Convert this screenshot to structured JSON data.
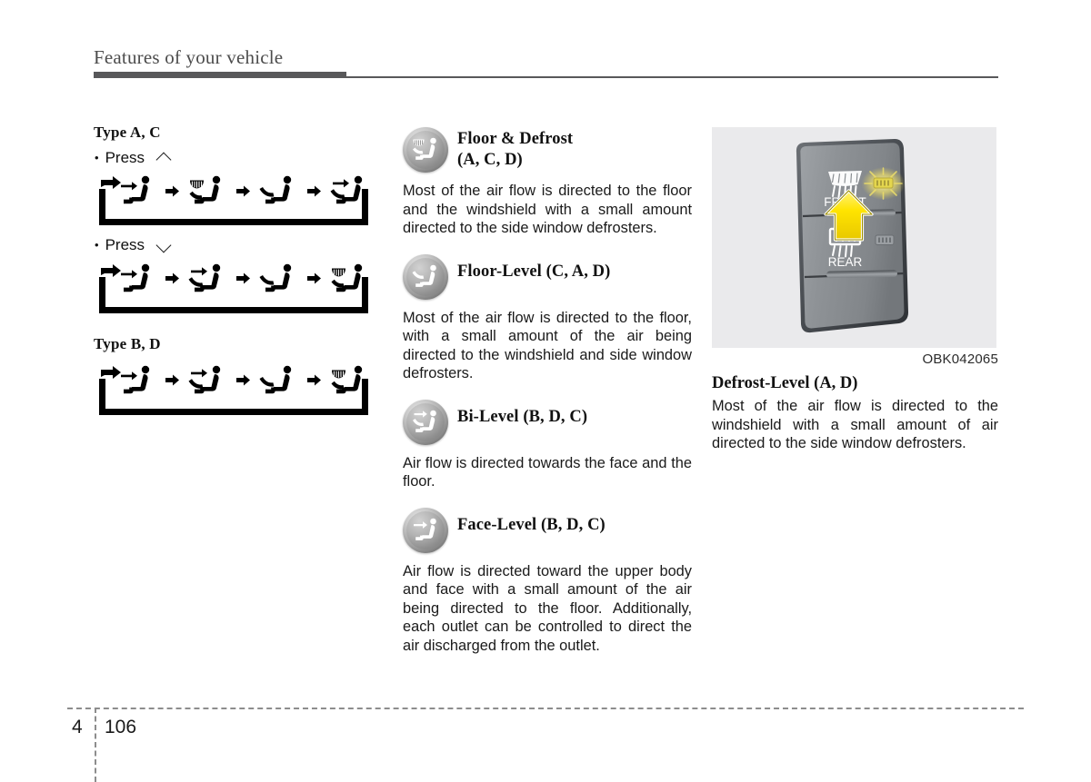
{
  "header": {
    "title": "Features of your vehicle"
  },
  "left_column": {
    "type_ac_heading": "Type A, C",
    "press_up": {
      "bullet": "•",
      "label": "Press",
      "icon": "chevron-up-icon"
    },
    "press_down": {
      "bullet": "•",
      "label": "Press",
      "icon": "chevron-down-icon"
    },
    "type_bd_heading": "Type B, D",
    "flow_up": {
      "name": "airflow-cycle-press-up",
      "modes": [
        "face-level",
        "floor-and-defrost",
        "floor-level",
        "bi-level"
      ]
    },
    "flow_down": {
      "name": "airflow-cycle-press-down",
      "modes": [
        "face-level",
        "bi-level",
        "floor-level",
        "floor-and-defrost"
      ]
    },
    "flow_bd": {
      "name": "airflow-cycle-type-b-d",
      "modes": [
        "face-level",
        "bi-level",
        "floor-level",
        "floor-and-defrost"
      ]
    }
  },
  "mid_column": {
    "entries": [
      {
        "icon": "floor-and-defrost-icon",
        "title_line1": "Floor & Defrost",
        "title_line2": "(A, C, D)",
        "body": "Most of the air flow is directed to the floor and the windshield with a small amount directed to the side window defrosters."
      },
      {
        "icon": "floor-level-icon",
        "title_line1": "Floor-Level (C, A, D)",
        "title_line2": "",
        "body": "Most of the air flow is directed to the floor, with a small amount of the air being directed to the windshield and side window defrosters."
      },
      {
        "icon": "bi-level-icon",
        "title_line1": "Bi-Level (B, D, C)",
        "title_line2": "",
        "body": "Air flow is directed towards the face and the floor."
      },
      {
        "icon": "face-level-icon",
        "title_line1": "Face-Level (B, D, C)",
        "title_line2": "",
        "body": "Air flow is directed toward the upper body and face with a small amount of the air being directed to the floor. Additionally, each outlet can be controlled to direct the air discharged from the outlet."
      }
    ]
  },
  "right_column": {
    "figure": {
      "name": "defroster-switch-illustration",
      "front_label": "FRONT",
      "rear_label": "REAR",
      "front_icon": "front-defrost-icon",
      "rear_icon": "rear-defrost-icon",
      "indicator_icon": "indicator-lamp-on-icon",
      "rear_indicator_icon": "rear-indicator-lamp-icon",
      "pointer_icon": "yellow-up-arrow-icon"
    },
    "figure_code": "OBK042065",
    "title": "Defrost-Level (A, D)",
    "body": "Most of the air flow is directed to the windshield with a small amount of air directed to the side window defrosters."
  },
  "footer": {
    "chapter": "4",
    "page": "106"
  },
  "colors": {
    "rule": "#58585a",
    "panel_bg": "#eaeaec",
    "indicator_yellow": "#f2e24a",
    "pointer_yellow": "#ffe400",
    "text": "#1a1a1a"
  }
}
